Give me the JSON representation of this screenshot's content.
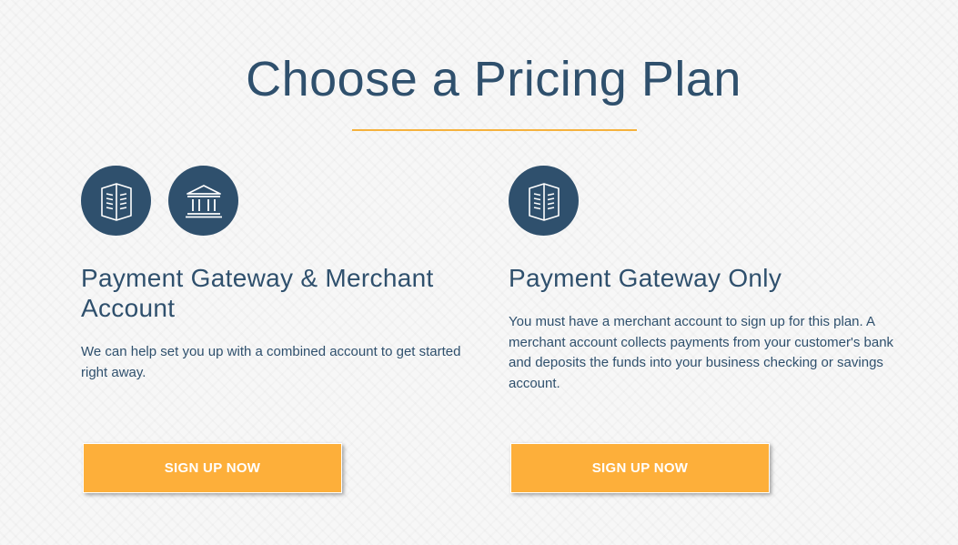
{
  "header": {
    "title": "Choose a Pricing Plan"
  },
  "colors": {
    "accent": "#f5b23d",
    "button": "#fdaf3a",
    "primary": "#2f506d"
  },
  "plans": [
    {
      "icons": [
        "document-icon",
        "bank-icon"
      ],
      "title": "Payment Gateway & Merchant Account",
      "description": "We can help set you up with a combined account to get started right away.",
      "button_label": "SIGN UP NOW"
    },
    {
      "icons": [
        "document-icon"
      ],
      "title": "Payment Gateway Only",
      "description": "You must have a merchant account to sign up for this plan. A merchant account collects payments from your customer's bank and deposits the funds into your business checking or savings account.",
      "button_label": "SIGN UP NOW"
    }
  ]
}
